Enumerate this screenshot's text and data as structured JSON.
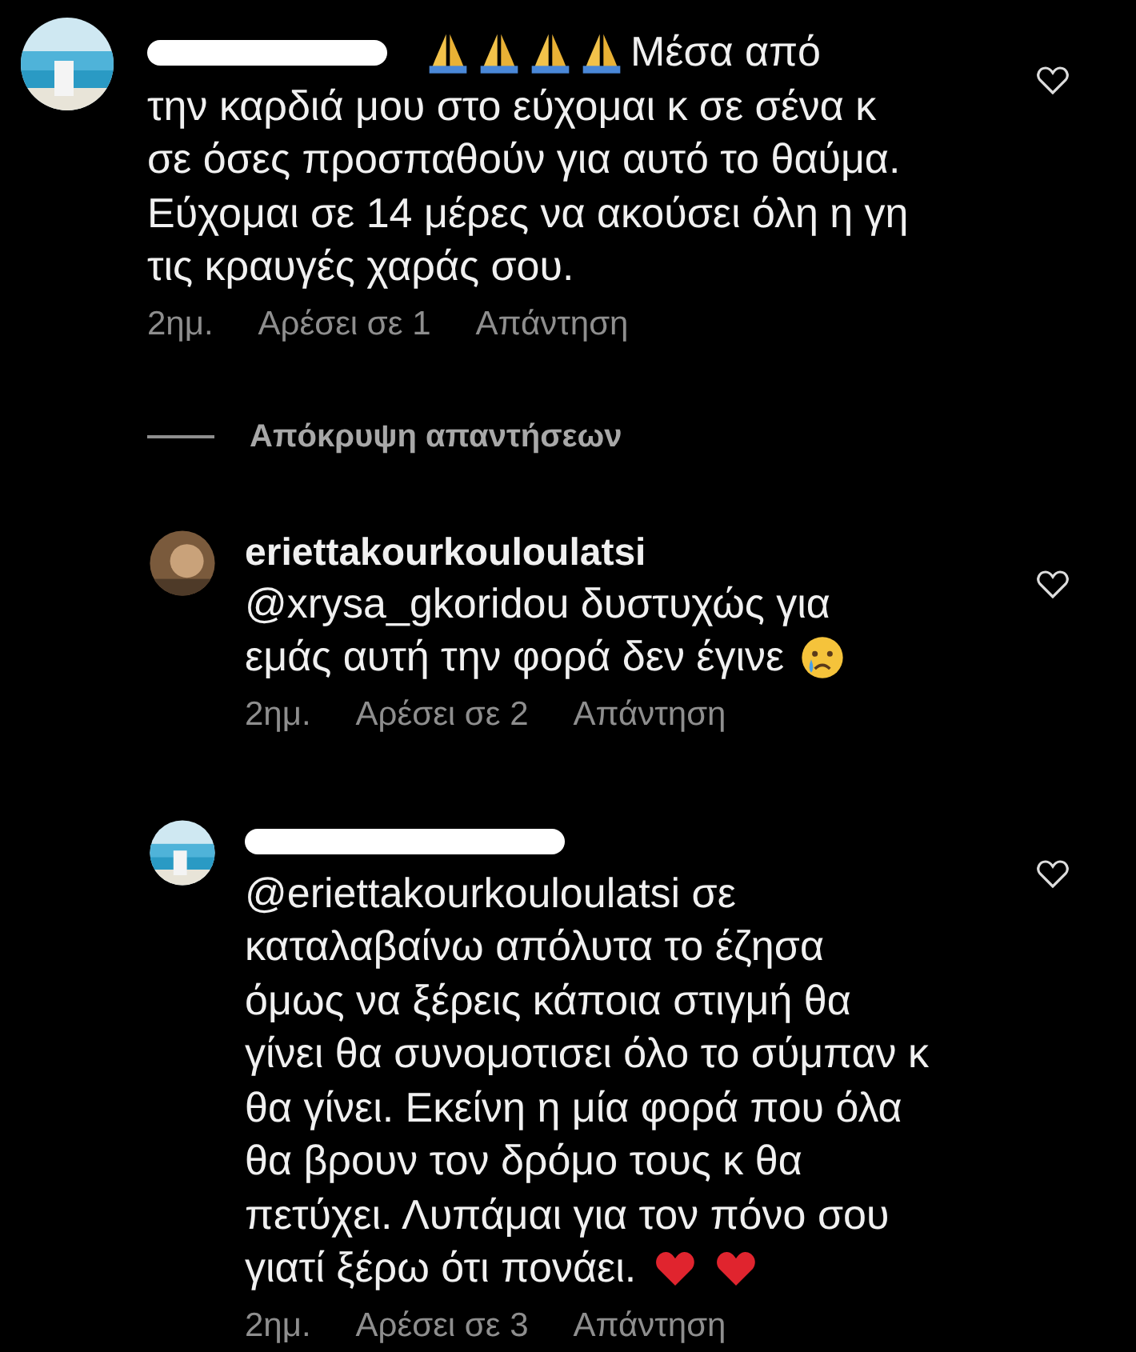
{
  "comments": [
    {
      "username_redacted": true,
      "inline_username": true,
      "body": [
        [
          {
            "kind": "pray"
          },
          {
            "kind": "pray"
          },
          {
            "kind": "pray"
          },
          {
            "kind": "pray"
          },
          {
            "kind": "text",
            "text": "Μέσα από"
          }
        ],
        [
          {
            "kind": "text",
            "text": "την καρδιά μου στο εύχομαι κ σε σένα κ σε όσες προσπαθούν για αυτό το θαύμα. Εύχομαι σε 14 μέρες να ακούσει όλη η γη τις κραυγές χαράς σου."
          }
        ]
      ],
      "time": "2ημ.",
      "likes": "Αρέσει σε 1",
      "reply": "Απάντηση",
      "hide_replies": "Απόκρυψη απαντήσεων",
      "replies": [
        {
          "username": "eriettakourkouloulatsi",
          "body": [
            [
              {
                "kind": "text",
                "text": "@xrysa_gkoridou δυστυχώς για"
              }
            ],
            [
              {
                "kind": "text",
                "text": "εμάς αυτή την φορά δεν έγινε"
              },
              {
                "kind": "cry"
              }
            ]
          ],
          "time": "2ημ.",
          "likes": "Αρέσει σε 2",
          "reply": "Απάντηση"
        },
        {
          "username_redacted": true,
          "body": [
            [
              {
                "kind": "text",
                "text": "@eriettakourkouloulatsi σε καταλαβαίνω απόλυτα το έζησα όμως να ξέρεις κάποια στιγμή θα γίνει θα συνομοτισει όλο το σύμπαν κ θα γίνει. Εκείνη η μία φορά που όλα θα βρουν τον δρόμο τους κ θα πετύχει. Λυπάμαι για τον πόνο σου"
              }
            ],
            [
              {
                "kind": "text",
                "text": "γιατί ξέρω ότι πονάει."
              },
              {
                "kind": "heart"
              },
              {
                "kind": "heart"
              }
            ]
          ],
          "time": "2ημ.",
          "likes": "Αρέσει σε 3",
          "reply": "Απάντηση"
        }
      ]
    }
  ]
}
